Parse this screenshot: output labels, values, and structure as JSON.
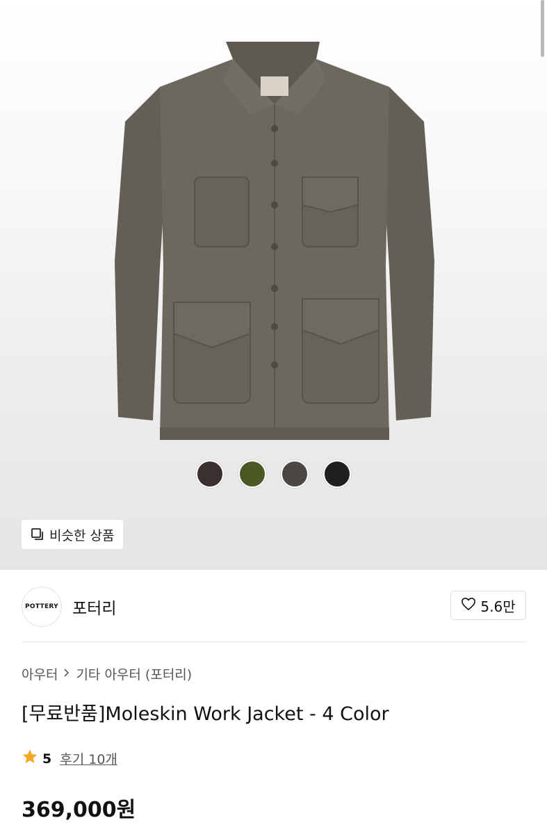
{
  "swatches": [
    {
      "color": "#3b302d",
      "label": "brown"
    },
    {
      "color": "#4b5a24",
      "label": "olive"
    },
    {
      "color": "#4a4745",
      "label": "charcoal"
    },
    {
      "color": "#1e1f21",
      "label": "black"
    }
  ],
  "similar_button": {
    "label": "비슷한 상품",
    "icon": "copy-icon"
  },
  "brand": {
    "logo_text": "POTTERY",
    "name": "포터리",
    "likes": "5.6만"
  },
  "breadcrumb": {
    "level1": "아우터",
    "level2": "기타 아우터 (포터리)"
  },
  "product": {
    "title": "[무료반품]Moleskin Work Jacket - 4 Color",
    "rating": "5",
    "reviews": "후기 10개",
    "price": "369,000원"
  },
  "colors": {
    "star": "#f5a623",
    "jacket": "#6b665c"
  }
}
